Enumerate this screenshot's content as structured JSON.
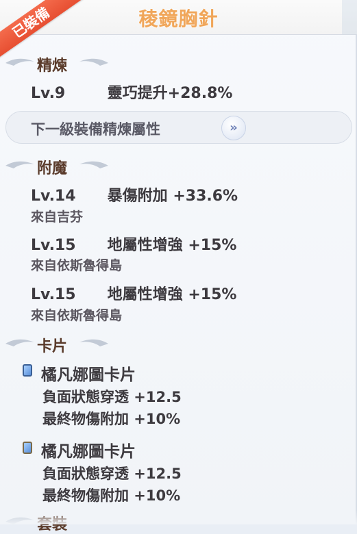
{
  "header": {
    "title": "稜鏡胸針",
    "ribbon": "已裝備"
  },
  "sections": {
    "refine": {
      "title": "精煉",
      "level": "Lv.9",
      "value": "靈巧提升+28.8%",
      "next_button_label": "下一級裝備精煉屬性",
      "next_button_icon": "double-chevron-right-icon"
    },
    "enchant": {
      "title": "附魔",
      "items": [
        {
          "level": "Lv.14",
          "value": "暴傷附加 +33.6%",
          "source": "來自吉芬"
        },
        {
          "level": "Lv.15",
          "value": "地屬性增強 +15%",
          "source": "來自依斯魯得島"
        },
        {
          "level": "Lv.15",
          "value": "地屬性增強 +15%",
          "source": "來自依斯魯得島"
        }
      ]
    },
    "card": {
      "title": "卡片",
      "items": [
        {
          "name": "橘凡娜圖卡片",
          "stats": [
            "負面狀態穿透 +12.5",
            "最終物傷附加 +10%"
          ]
        },
        {
          "name": "橘凡娜圖卡片",
          "stats": [
            "負面狀態穿透 +12.5",
            "最終物傷附加 +10%"
          ]
        }
      ]
    },
    "set": {
      "title": "套裝"
    }
  },
  "colors": {
    "title": "#f0a65a",
    "ribbon": "#e74f32",
    "section_title": "#5a3b2b",
    "text": "#3d3a3f"
  }
}
